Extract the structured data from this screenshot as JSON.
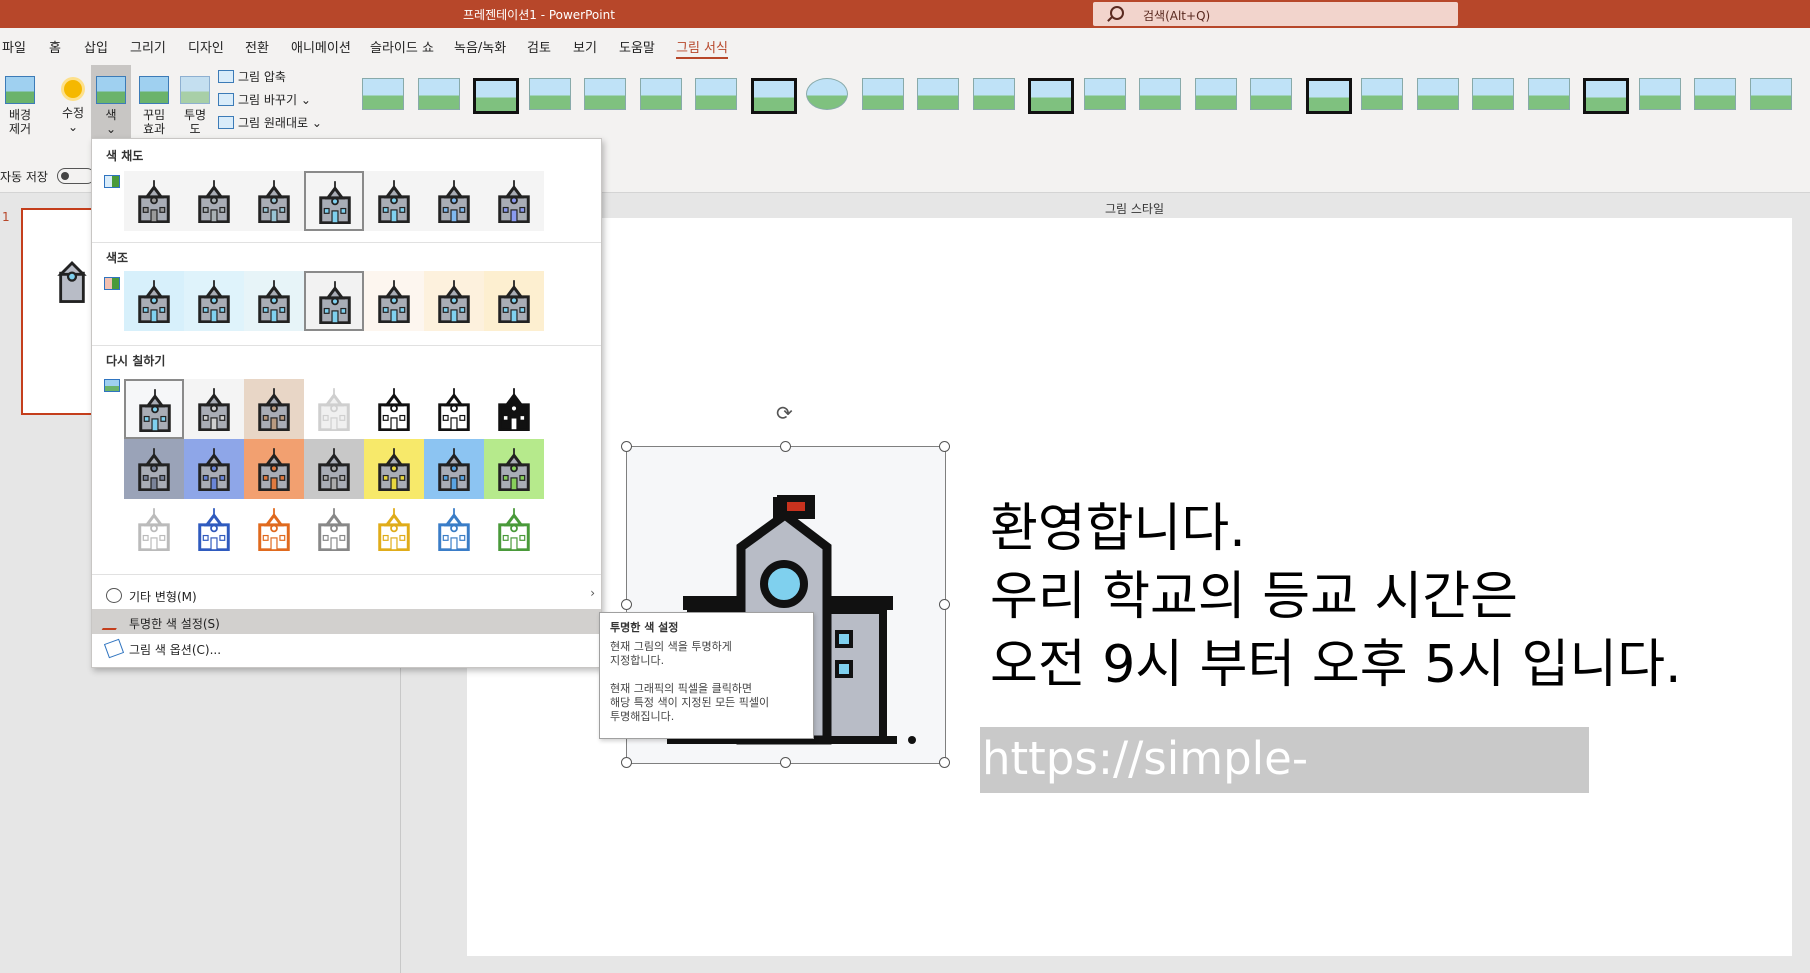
{
  "window": {
    "title": "프레젠테이션1  -  PowerPoint",
    "search_placeholder": "검색(Alt+Q)"
  },
  "menu_tabs": [
    "파일",
    "홈",
    "삽입",
    "그리기",
    "디자인",
    "전환",
    "애니메이션",
    "슬라이드 쇼",
    "녹음/녹화",
    "검토",
    "보기",
    "도움말",
    "그림 서식"
  ],
  "active_tab": "그림 서식",
  "ribbon": {
    "remove_bg": [
      "배경",
      "제거"
    ],
    "corrections": "수정",
    "color": "색",
    "artistic": [
      "꾸밈",
      "효과"
    ],
    "transparency": [
      "투명",
      "도"
    ],
    "compress": "그림 압축",
    "change": "그림 바꾸기",
    "reset": "그림 원래대로",
    "styles_group_label": "그림 스타일",
    "style_count": 26
  },
  "qat": {
    "autosave": "자동 저장"
  },
  "slide_pane": {
    "slide_number": "1"
  },
  "color_menu": {
    "sec1": "색 채도",
    "sec2": "색조",
    "sec3": "다시 칠하기",
    "saturation_bg": [
      "#f4f4f4",
      "#f4f4f4",
      "#f4f4f4",
      "#f4f4f4",
      "#f4f4f4",
      "#f4f4f4",
      "#f4f4f4"
    ],
    "tone_bg": [
      "#d7f0fb",
      "#dff3fb",
      "#e7f4f8",
      "#f2f2f2",
      "#fdf6ef",
      "#fdf1dd",
      "#fdefd0"
    ],
    "recolor_row1_bg": [
      "#f6f7f9",
      "#f4f4f4",
      "#e8d6c6",
      "#ffffff",
      "#ffffff",
      "#ffffff",
      "#ffffff"
    ],
    "recolor_row2_bg": [
      "#9aa3b8",
      "#8ea6e8",
      "#f2a070",
      "#c8c8c8",
      "#f7e96a",
      "#8cc4f2",
      "#b6ea8c"
    ],
    "recolor_row3_bg": [
      "#ffffff",
      "#ffffff",
      "#ffffff",
      "#ffffff",
      "#ffffff",
      "#ffffff",
      "#ffffff"
    ],
    "recolor_row3_ink": [
      "#bbbbbb",
      "#2f5bbf",
      "#e06a1e",
      "#888888",
      "#e0ac1a",
      "#3a7dc8",
      "#4a9a3a"
    ],
    "cmd_more": "기타 변형(M)",
    "cmd_transparent": "투명한 색 설정(S)",
    "cmd_options": "그림 색 옵션(C)..."
  },
  "tooltip": {
    "title": "투명한 색 설정",
    "body": [
      "현재 그림의 색을 투명하게",
      "지정합니다.",
      "",
      "현재 그래픽의 픽셀을 클릭하면",
      "해당 특정 색이 지정된 모든 픽셀이",
      "투명해집니다."
    ]
  },
  "slide": {
    "lines": [
      "환영합니다.",
      "우리 학교의 등교 시간은",
      "오전 9시 부터 오후 5시 입니다."
    ],
    "url": "https://simple-phil.tistory.com"
  }
}
